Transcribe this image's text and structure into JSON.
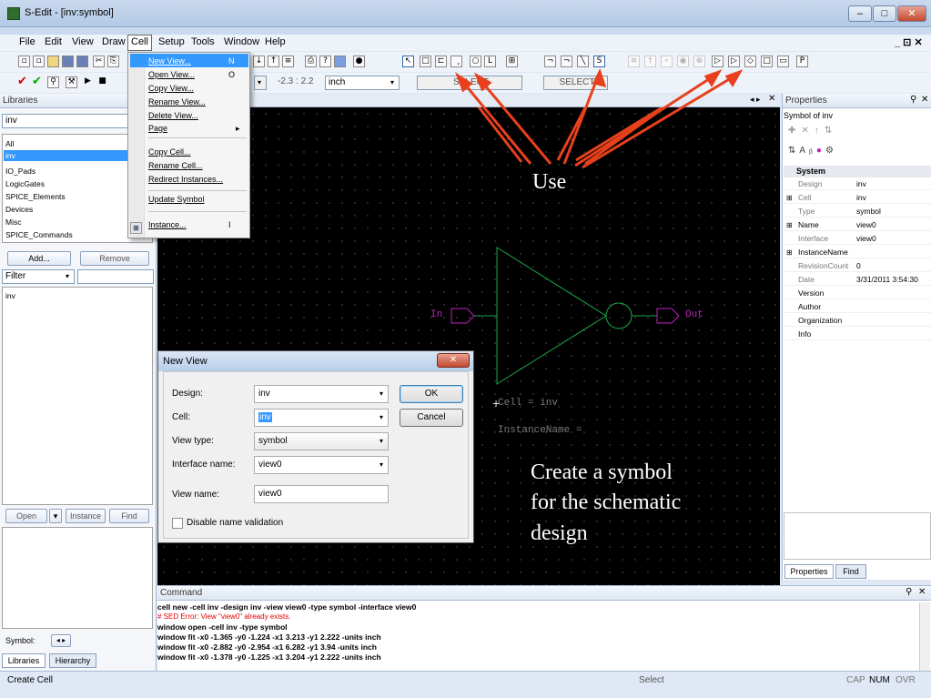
{
  "window": {
    "title": "S-Edit - [inv:symbol]",
    "min": "–",
    "max": "□",
    "close": "✕"
  },
  "menu": {
    "items": [
      "File",
      "Edit",
      "View",
      "Draw",
      "Cell",
      "Setup",
      "Tools",
      "Window",
      "Help"
    ],
    "mdi_controls": "_ ⊡ ✕"
  },
  "toolbar": {
    "coord_readout": "-2.3 : 2.2",
    "units": "inch",
    "select_left": "SELECT",
    "select_right": "SELECT"
  },
  "cell_menu": {
    "items": [
      {
        "label": "New View...",
        "shortcut": "N"
      },
      {
        "label": "Open View...",
        "shortcut": "O"
      },
      {
        "label": "Copy View...",
        "shortcut": ""
      },
      {
        "label": "Rename View...",
        "shortcut": ""
      },
      {
        "label": "Delete View...",
        "shortcut": ""
      },
      {
        "label": "Page",
        "shortcut": "▸"
      },
      {
        "label": "Copy Cell...",
        "shortcut": ""
      },
      {
        "label": "Rename Cell...",
        "shortcut": ""
      },
      {
        "label": "Redirect Instances...",
        "shortcut": ""
      },
      {
        "label": "Update Symbol",
        "shortcut": ""
      },
      {
        "label": "Instance...",
        "shortcut": "I"
      }
    ]
  },
  "libraries": {
    "header": "Libraries",
    "selected": "inv",
    "list": [
      "All",
      "inv",
      "IO_Pads",
      "LogicGates",
      "SPICE_Elements",
      "Devices",
      "Misc",
      "SPICE_Commands"
    ],
    "selected_index": 1,
    "add_label": "Add...",
    "remove_label": "Remove",
    "filter_label": "Filter",
    "cells": [
      "inv"
    ],
    "open_label": "Open",
    "instance_label": "Instance",
    "find_label": "Find",
    "symbol_label": "Symbol:",
    "tabs": [
      "Libraries",
      "Hierarchy"
    ]
  },
  "schematic": {
    "pin_in": "In",
    "pin_out": "Out",
    "cell_text": "Cell = inv",
    "instance_text": "InstanceName =",
    "wire_color": "#1aa84a",
    "pin_color": "#c020c0"
  },
  "annotations": {
    "use": "Use",
    "create_line1": "Create a symbol",
    "create_line2": "for the schematic",
    "create_line3": "design",
    "arrow_color": "#e8401c"
  },
  "dialog": {
    "title": "New View",
    "close": "✕",
    "fields": [
      {
        "label": "Design:",
        "value": "inv"
      },
      {
        "label": "Cell:",
        "value": "inv"
      },
      {
        "label": "View type:",
        "value": "symbol"
      },
      {
        "label": "Interface name:",
        "value": "view0"
      },
      {
        "label": "View name:",
        "value": "view0"
      }
    ],
    "checkbox_label": "Disable name validation",
    "ok_label": "OK",
    "cancel_label": "Cancel"
  },
  "properties": {
    "header": "Properties",
    "object": "Symbol of inv",
    "section": "System",
    "rows": [
      {
        "k": "Design",
        "v": "inv",
        "dim": true
      },
      {
        "k": "Cell",
        "v": "inv",
        "dim": true,
        "exp": true
      },
      {
        "k": "Type",
        "v": "symbol",
        "dim": true
      },
      {
        "k": "Name",
        "v": "view0",
        "dim": false,
        "exp": true
      },
      {
        "k": "Interface",
        "v": "view0",
        "dim": true
      },
      {
        "k": "InstanceName",
        "v": "",
        "dim": false,
        "exp": true
      },
      {
        "k": "RevisionCount",
        "v": "0",
        "dim": true
      },
      {
        "k": "Date",
        "v": "3/31/2011 3:54:30",
        "dim": true
      },
      {
        "k": "Version",
        "v": "",
        "dim": false
      },
      {
        "k": "Author",
        "v": "",
        "dim": false
      },
      {
        "k": "Organization",
        "v": "",
        "dim": false
      },
      {
        "k": "Info",
        "v": "",
        "dim": false
      }
    ],
    "tabs": [
      "Properties",
      "Find"
    ]
  },
  "command": {
    "header": "Command",
    "lines": [
      {
        "text": "cell new -cell inv -design inv -view view0 -type symbol -interface view0",
        "color": "#000000"
      },
      {
        "text": "# SED  Error: View \"view0\" already exists.",
        "color": "#e00000"
      },
      {
        "text": "window open -cell inv -type symbol",
        "color": "#000000"
      },
      {
        "text": "window fit -x0 -1.365 -y0 -1.224 -x1 3.213 -y1 2.222 -units inch",
        "color": "#000000"
      },
      {
        "text": "window fit -x0 -2.882 -y0 -2.954 -x1 6.282 -y1 3.94 -units inch",
        "color": "#000000"
      },
      {
        "text": "window fit -x0 -1.378 -y0 -1.225 -x1 3.204 -y1 2.222 -units inch",
        "color": "#000000"
      }
    ]
  },
  "status": {
    "left": "Create Cell",
    "mode": "Select",
    "cap": "CAP",
    "num": "NUM",
    "ovr": "OVR"
  }
}
